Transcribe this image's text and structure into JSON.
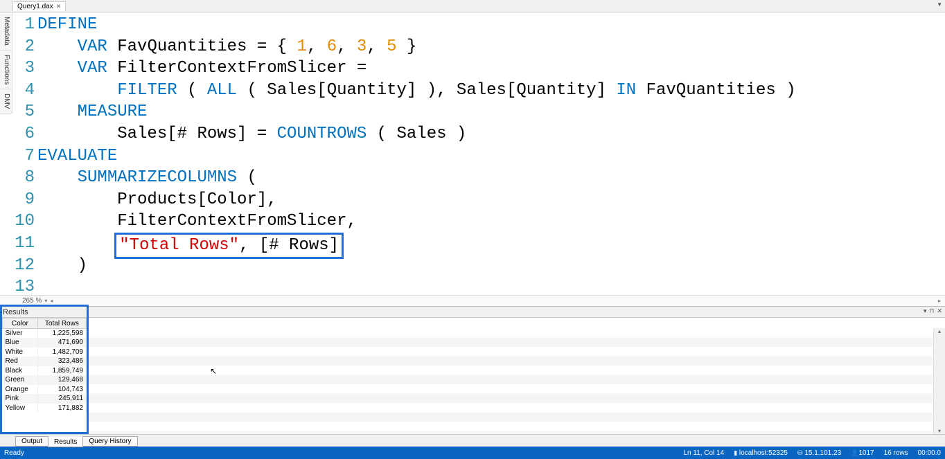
{
  "tab": {
    "title": "Query1.dax"
  },
  "side_tabs": [
    "Metadata",
    "Functions",
    "DMV"
  ],
  "code": {
    "lines": [
      {
        "kw": "DEFINE",
        "rest": "",
        "indent": 0
      },
      {
        "pre": "    ",
        "kw": "VAR",
        "rest": " FavQuantities = { ",
        "nums": [
          "1",
          "6",
          "3",
          "5"
        ],
        "sep": ", ",
        "close": " }"
      },
      {
        "pre": "    ",
        "kw": "VAR",
        "rest": " FilterContextFromSlicer ="
      },
      {
        "pre": "        ",
        "fn": "FILTER",
        "rest1": " ( ",
        "fn2": "ALL",
        "rest2": " ( Sales[Quantity] ), Sales[Quantity] ",
        "kw2": "IN",
        "rest3": " FavQuantities )"
      },
      {
        "pre": "    ",
        "kw": "MEASURE"
      },
      {
        "pre": "        ",
        "txt1": "Sales[# Rows] = ",
        "fn": "COUNTROWS",
        "txt2": " ( Sales )"
      },
      {
        "kw": "EVALUATE"
      },
      {
        "pre": "    ",
        "fn": "SUMMARIZECOLUMNS",
        "rest": " ("
      },
      {
        "pre": "        ",
        "txt": "Products[Color],"
      },
      {
        "pre": "        ",
        "txt": "FilterContextFromSlicer,"
      },
      {
        "pre": "        ",
        "highlight": true,
        "str": "\"Total Rows\"",
        "txt": ", [# Rows]"
      },
      {
        "pre": "    ",
        "txt": ")"
      },
      {
        "pre": "",
        "txt": ""
      }
    ]
  },
  "zoom": "265 %",
  "results": {
    "title": "Results",
    "columns": [
      "Color",
      "Total Rows"
    ],
    "rows": [
      [
        "Silver",
        "1,225,598"
      ],
      [
        "Blue",
        "471,690"
      ],
      [
        "White",
        "1,482,709"
      ],
      [
        "Red",
        "323,486"
      ],
      [
        "Black",
        "1,859,749"
      ],
      [
        "Green",
        "129,468"
      ],
      [
        "Orange",
        "104,743"
      ],
      [
        "Pink",
        "245,911"
      ],
      [
        "Yellow",
        "171,882"
      ]
    ]
  },
  "bottom_tabs": {
    "output": "Output",
    "results": "Results",
    "history": "Query History"
  },
  "status": {
    "ready": "Ready",
    "pos": "Ln 11, Col 14",
    "host": "localhost:52325",
    "version": "15.1.101.23",
    "users": "1017",
    "rows": "16 rows",
    "time": "00:00.0"
  }
}
